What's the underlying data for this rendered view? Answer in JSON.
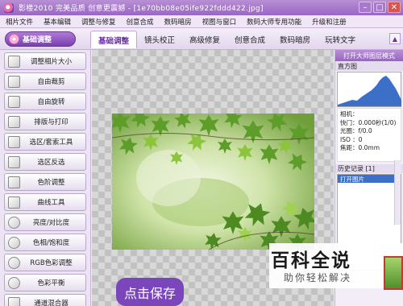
{
  "window": {
    "title": "影楼2010  完美品质  创意更震撼 - [1e70bb08e05ife922fddd422.jpg]",
    "controls": [
      "–",
      "□",
      "✕"
    ]
  },
  "menu": [
    "相片文件",
    "基本编辑",
    "调整与修复",
    "创意合成",
    "数码暗房",
    "视图与窗口",
    "数码大师专用功能",
    "升级和注册"
  ],
  "tabbar": {
    "main_button": "基础调整",
    "tabs": [
      "基础调整",
      "镜头校正",
      "高级修复",
      "创意合成",
      "数码暗房",
      "玩转文字"
    ],
    "active_tab": "基础调整"
  },
  "tools": [
    {
      "label": "调整相片大小",
      "icon": "resize-icon"
    },
    {
      "label": "自由裁剪",
      "icon": "crop-icon"
    },
    {
      "label": "自由旋转",
      "icon": "rotate-icon"
    },
    {
      "label": "排版与打印",
      "icon": "print-icon"
    },
    {
      "label": "选区/套索工具",
      "icon": "lasso-icon"
    },
    {
      "label": "选区反选",
      "icon": "invert-selection-icon"
    },
    {
      "label": "色阶调整",
      "icon": "levels-icon"
    },
    {
      "label": "曲线工具",
      "icon": "curves-icon"
    },
    {
      "label": "亮度/对比度",
      "icon": "brightness-icon"
    },
    {
      "label": "色相/饱和度",
      "icon": "hue-icon"
    },
    {
      "label": "RGB色彩调整",
      "icon": "rgb-icon"
    },
    {
      "label": "色彩平衡",
      "icon": "color-balance-icon"
    },
    {
      "label": "通道混合器",
      "icon": "channel-mixer-icon"
    }
  ],
  "canvas": {
    "save_overlay": "点击保存"
  },
  "rightpanel": {
    "header": "打开大师图层模式",
    "histogram_title": "直方图",
    "info": [
      "相机：",
      "快门：0.000秒(1/0)",
      "光圈：f/0.0",
      "ISO ：0",
      "焦距：0.0mm"
    ],
    "history_title": "历史记录 [1]",
    "history_items": [
      "打开图片"
    ]
  },
  "watermark": {
    "logo": "百科全说",
    "sub": "助你轻松解决"
  },
  "colors": {
    "accent": "#7b45bb",
    "titlebar": "#9a66c4",
    "selection": "#3b6fc8"
  }
}
